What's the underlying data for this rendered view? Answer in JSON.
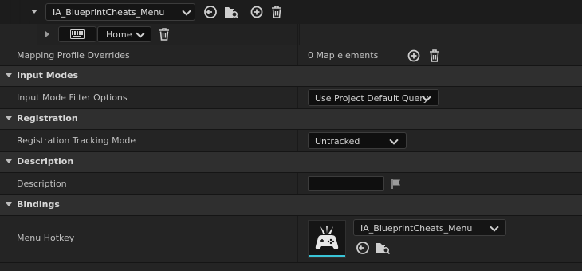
{
  "top_mapping": {
    "action_value": "IA_BlueprintCheats_Menu",
    "key_label": "Home"
  },
  "rows": {
    "mapping_overrides": {
      "label": "Mapping Profile Overrides",
      "value": "0 Map elements"
    },
    "input_modes": {
      "title": "Input Modes"
    },
    "input_mode_filter": {
      "label": "Input Mode Filter Options",
      "value": "Use Project Default Query"
    },
    "registration": {
      "title": "Registration"
    },
    "registration_tracking": {
      "label": "Registration Tracking Mode",
      "value": "Untracked"
    },
    "description_cat": {
      "title": "Description"
    },
    "description": {
      "label": "Description",
      "value": ""
    },
    "bindings": {
      "title": "Bindings"
    },
    "menu_hotkey": {
      "label": "Menu Hotkey",
      "value": "IA_BlueprintCheats_Menu"
    }
  },
  "icons": {
    "reset": "reset-arrow-icon",
    "browse": "browse-asset-icon",
    "add": "add-circle-icon",
    "delete": "trash-icon",
    "keyboard": "keyboard-icon",
    "flag": "flag-icon",
    "gamepad": "gamepad-icon"
  },
  "colors": {
    "accent": "#39c4d6",
    "panel": "#242424",
    "category": "#2f2f2f"
  }
}
